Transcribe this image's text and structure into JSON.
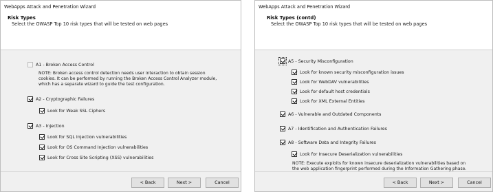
{
  "left": {
    "window_title": "WebApps Attack and Penetration Wizard",
    "header": {
      "title": "Risk Types",
      "subtitle": "Select the OWASP Top 10 risk types that will be tested on web pages"
    },
    "a1": {
      "label": "A1 - Broken Access Control",
      "checked": false,
      "enabled": false
    },
    "a1_note": [
      "NOTE: Broken access control detection needs user interaction to obtain session",
      "cookies. It can be performed by running the Broken Access Control Analyzer module,",
      "which has a separate wizard to guide the test configuration."
    ],
    "a2": {
      "label": "A2 - Cryptographic Failures",
      "checked": true,
      "options": [
        {
          "label": "Look for Weak SSL Ciphers",
          "checked": true
        }
      ]
    },
    "a3": {
      "label": "A3 - Injection",
      "checked": true,
      "options": [
        {
          "label": "Look for SQL Injection vulnerabilities",
          "checked": true
        },
        {
          "label": "Look for OS Command Injection vulnerabilities",
          "checked": true
        },
        {
          "label": "Look for Cross Site Scripting (XSS) vulnerabilities",
          "checked": true
        }
      ]
    },
    "buttons": {
      "back": "< Back",
      "next": "Next >",
      "cancel": "Cancel"
    }
  },
  "right": {
    "window_title": "WebApps Attack and Penetration Wizard",
    "header": {
      "title": "Risk Types (contd)",
      "subtitle": "Select the OWASP Top 10 risk types that will be tested on web pages"
    },
    "a5": {
      "label": "A5 - Security Misconfiguration",
      "checked": true,
      "options": [
        {
          "label": "Look for known security misconfiguration issues",
          "checked": true
        },
        {
          "label": "Look for WebDAV vulnerabilities",
          "checked": true
        },
        {
          "label": "Look for default host credentials",
          "checked": true
        },
        {
          "label": "Look for XML External Entities",
          "checked": true
        }
      ]
    },
    "a6": {
      "label": "A6 - Vulnerable and Outdated Components",
      "checked": true
    },
    "a7": {
      "label": "A7 - Identification and Authentication Failures",
      "checked": true
    },
    "a8": {
      "label": "A8 - Software Data and Integrity Failures",
      "checked": true,
      "options": [
        {
          "label": "Look for Insecure Deserialization vulnerabilities",
          "checked": true
        }
      ]
    },
    "a8_note": [
      "NOTE: Execute exploits for known insecure deserialization vulnerabilities based on",
      "the web application fingerprint performed during the Information Gathering phase."
    ],
    "buttons": {
      "back": "< Back",
      "next": "Next >",
      "cancel": "Cancel"
    }
  }
}
